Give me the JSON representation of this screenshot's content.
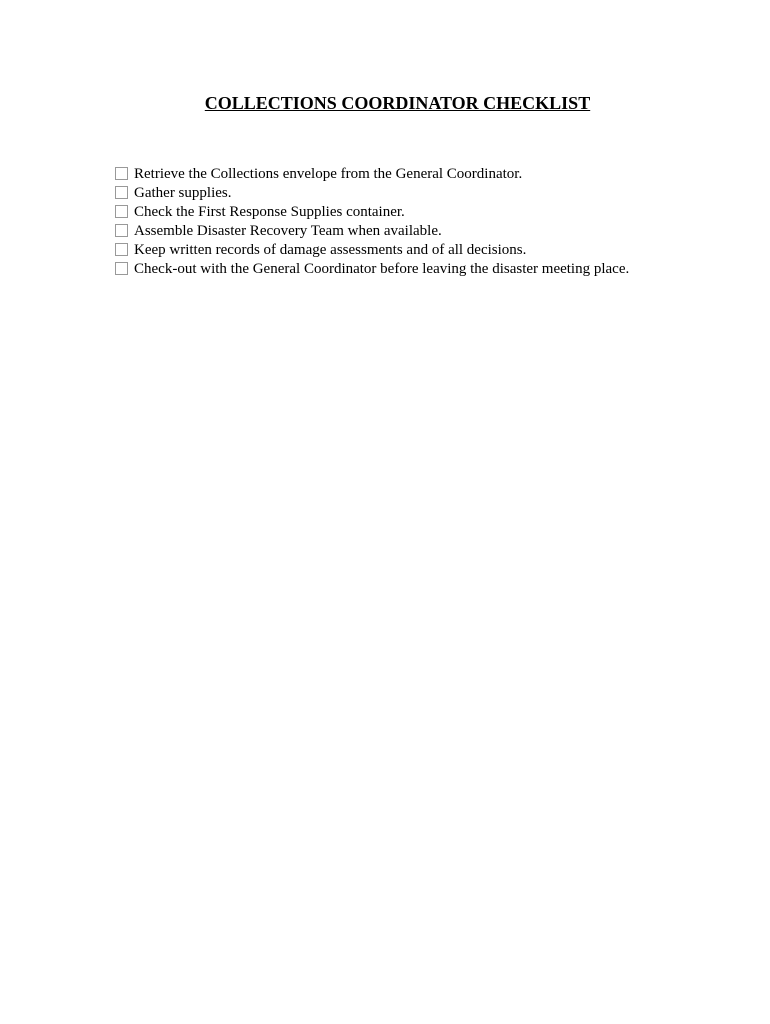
{
  "title": "COLLECTIONS COORDINATOR CHECKLIST",
  "checklist": {
    "items": [
      {
        "text": "Retrieve the Collections envelope from the General Coordinator."
      },
      {
        "text": "Gather supplies."
      },
      {
        "text": "Check the First Response Supplies container."
      },
      {
        "text": "Assemble Disaster Recovery Team when available."
      },
      {
        "text": "Keep written records of damage assessments and of all decisions."
      },
      {
        "text": "Check-out with the General Coordinator before leaving the disaster meeting place."
      }
    ]
  }
}
